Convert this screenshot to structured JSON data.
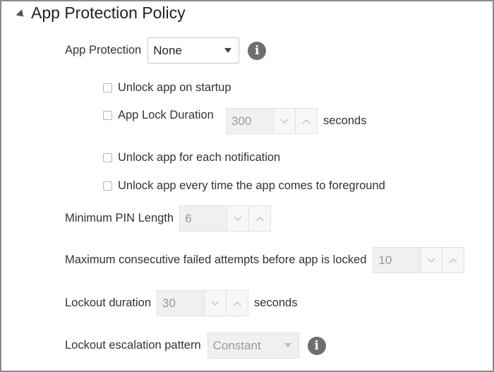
{
  "section": {
    "title": "App Protection Policy"
  },
  "app_protection": {
    "label": "App Protection",
    "value": "None"
  },
  "options": [
    {
      "label": "Unlock app on startup",
      "checked": false
    },
    {
      "label": "App Lock Duration",
      "checked": false
    },
    {
      "label": "Unlock app for each notification",
      "checked": false
    },
    {
      "label": "Unlock app every time the app comes to foreground",
      "checked": false
    }
  ],
  "app_lock_duration": {
    "value": "300",
    "unit": "seconds"
  },
  "min_pin": {
    "label": "Minimum PIN Length",
    "value": "6"
  },
  "max_failed": {
    "label": "Maximum consecutive failed attempts before app is locked",
    "value": "10"
  },
  "lockout_duration": {
    "label": "Lockout duration",
    "value": "30",
    "unit": "seconds"
  },
  "lockout_escalation": {
    "label": "Lockout escalation pattern",
    "value": "Constant"
  },
  "icons": {
    "info": "info-icon",
    "collapse": "collapse-triangle-icon",
    "dropdown": "dropdown-arrow-icon",
    "decrement": "chevron-down-icon",
    "increment": "chevron-up-icon"
  }
}
